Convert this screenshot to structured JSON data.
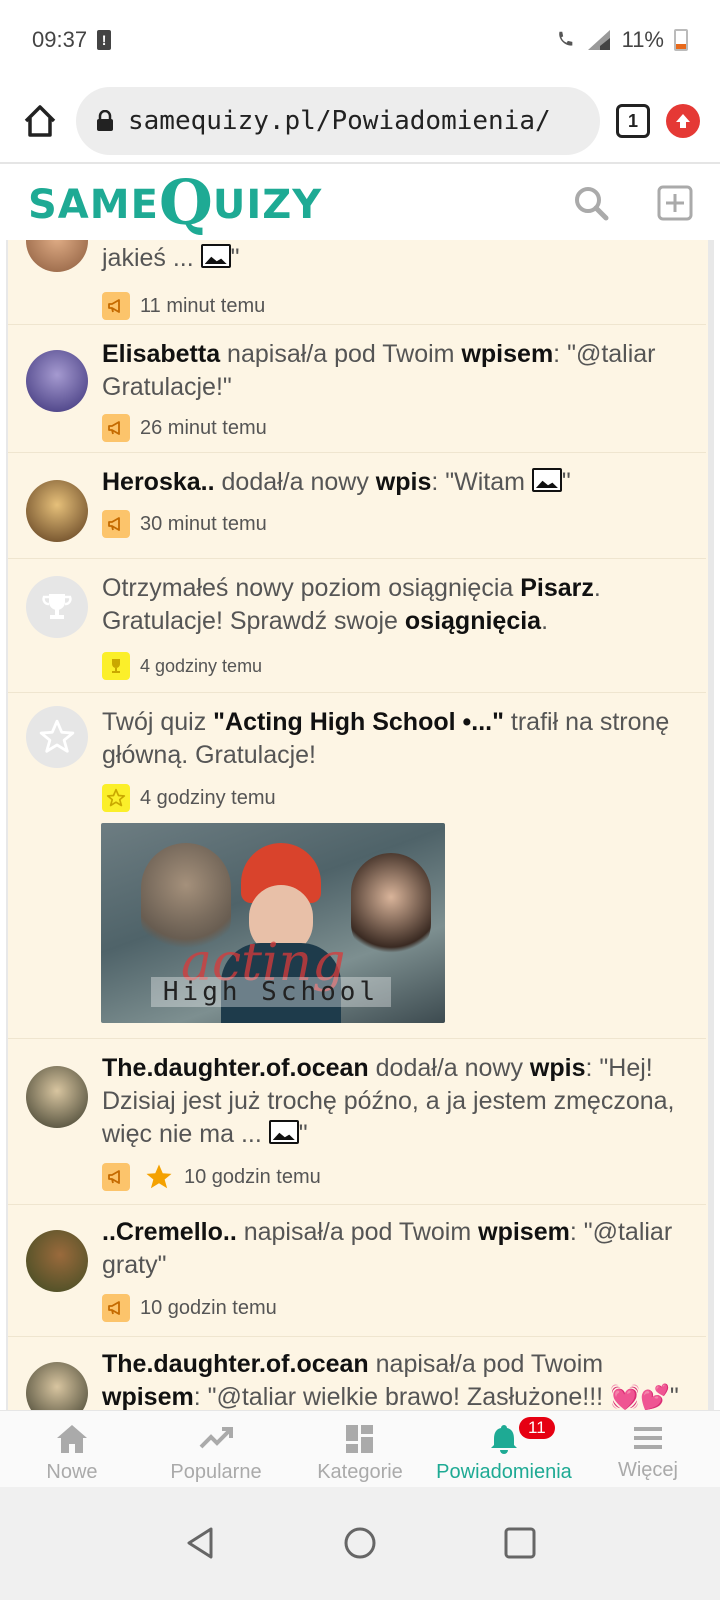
{
  "status_bar": {
    "time": "09:37",
    "alert": "!",
    "battery": "11%"
  },
  "browser": {
    "url": "samequizy.pl/Powiadomienia/",
    "tab_count": "1"
  },
  "site": {
    "logo_same": "SAME",
    "logo_q": "Q",
    "logo_uizy": "UIZY"
  },
  "colors": {
    "brand": "#1eaa94",
    "feed_bg": "#fdf5e4",
    "badge_orange": "#fcc46b",
    "badge_yellow": "#fbef2a",
    "notif_red": "#e60012"
  },
  "notifications": [
    {
      "text_start": "jakieś ... ",
      "text_end": "\"",
      "time": "11 minut temu",
      "badge": "megaphone-icon"
    },
    {
      "user": "Elisabetta",
      "action": " napisał/a pod Twoim ",
      "target": "wpisem",
      "content": ": \"@taliar Gratulacje!\"",
      "time": "26 minut temu",
      "badge": "megaphone-icon"
    },
    {
      "user": "Heroska..",
      "action": " dodał/a nowy ",
      "target": "wpis",
      "content": ": \"Witam ",
      "content_end": "\"",
      "time": "30 minut temu",
      "badge": "megaphone-icon"
    },
    {
      "text_a": "Otrzymałeś nowy poziom osiągnięcia ",
      "bold_a": "Pisarz",
      "text_b": ". Gratulacje! Sprawdź swoje ",
      "bold_b": "osiągnięcia",
      "text_c": ".",
      "time": "4 godziny temu",
      "badge": "trophy-icon"
    },
    {
      "text_a": "Twój quiz ",
      "bold_a": "\"Acting High School •...\"",
      "text_b": " trafił na stronę główną. Gratulacje!",
      "time": "4 godziny temu",
      "badge": "star-icon",
      "thumb_title": "acting",
      "thumb_subtitle": "High School"
    },
    {
      "user": "The.daughter.of.ocean",
      "action": " dodał/a nowy ",
      "target": "wpis",
      "content": ": \"Hej! Dzisiaj jest już trochę późno, a ja jestem zmęczona, więc nie ma ... ",
      "content_end": "\"",
      "time": "10 godzin temu",
      "badge": "megaphone-icon"
    },
    {
      "user": "..Cremello..",
      "action": " napisał/a pod Twoim ",
      "target": "wpisem",
      "content": ": \"@taliar graty\"",
      "time": "10 godzin temu",
      "badge": "megaphone-icon"
    },
    {
      "user": "The.daughter.of.ocean",
      "action": " napisał/a pod Twoim ",
      "target": "wpisem",
      "content": ": \"@taliar wielkie brawo! Zasłużone!!! ",
      "content_end": "\"",
      "hearts": "💓💕",
      "badge": "megaphone-icon"
    }
  ],
  "bottom_nav": [
    {
      "label": "Nowe",
      "icon": "home-icon"
    },
    {
      "label": "Popularne",
      "icon": "trending-icon"
    },
    {
      "label": "Kategorie",
      "icon": "grid-icon"
    },
    {
      "label": "Powiadomienia",
      "icon": "bell-icon",
      "badge": "11"
    },
    {
      "label": "Więcej",
      "icon": "menu-icon"
    }
  ]
}
